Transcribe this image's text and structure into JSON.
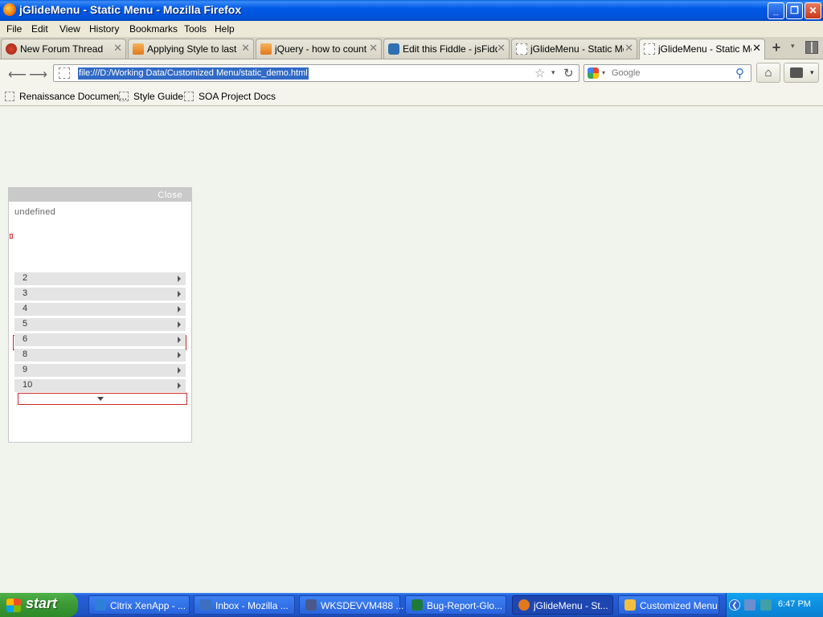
{
  "window": {
    "title": "jGlideMenu - Static Menu - Mozilla Firefox",
    "min_glyph": "_",
    "max_glyph": "❐",
    "close_glyph": "✕"
  },
  "menubar": [
    "File",
    "Edit",
    "View",
    "History",
    "Bookmarks",
    "Tools",
    "Help"
  ],
  "tabs": [
    {
      "label": "New Forum Thread",
      "icon": "forum-icon"
    },
    {
      "label": "Applying Style to last l...",
      "icon": "stackoverflow-icon"
    },
    {
      "label": "jQuery - how to count...",
      "icon": "stackoverflow-icon"
    },
    {
      "label": "Edit this Fiddle - jsFiddle",
      "icon": "jsfiddle-icon"
    },
    {
      "label": "jGlideMenu - Static Me...",
      "icon": "blank-page-icon"
    },
    {
      "label": "jGlideMenu - Static Me...",
      "icon": "blank-page-icon",
      "active": true
    }
  ],
  "tab_controls": {
    "new_tab": "+",
    "list": "▾"
  },
  "navbar": {
    "back": "⟵",
    "forward": "⟶",
    "url": "file:///D:/Working Data/Customized Menu/static_demo.html",
    "star": "☆",
    "dropdown": "▾",
    "reload": "↻",
    "search_placeholder": "Google",
    "search_dropdown": "▾",
    "search_button": "⚲",
    "home": "⌂",
    "addon_dropdown": "▾"
  },
  "bookmarks": [
    "Renaissance Documen...",
    "Style Guide",
    "SOA Project Docs"
  ],
  "page": {
    "close_label": "Close",
    "info_text": "undefined",
    "menu_items": [
      "2",
      "3",
      "4",
      "5",
      "6",
      "8",
      "9",
      "10"
    ]
  },
  "taskbar": {
    "start_label": "start",
    "tasks": [
      {
        "label": "Citrix XenApp - ...",
        "color": "#2f7fd8"
      },
      {
        "label": "Inbox - Mozilla ...",
        "color": "#3b6fc0"
      },
      {
        "label": "WKSDEVVM488 ...",
        "color": "#4a5a8a"
      },
      {
        "label": "Bug-Report-Glo...",
        "color": "#1f7a3a"
      },
      {
        "label": "jGlideMenu - St...",
        "color": "#e0791c",
        "active": true
      },
      {
        "label": "Customized Menu",
        "color": "#f0c040"
      }
    ],
    "tray_arrow": "❮",
    "clock": "6:47 PM"
  },
  "colors": {
    "titlebar": "#0058e6",
    "page_bg": "#f0f4ec",
    "panel_header": "#c9c9c9",
    "menu_item_bg": "#e4e4e4",
    "scroll_border": "#cc2b2b",
    "taskbar": "#245edb",
    "start_green": "#3c9a36"
  }
}
